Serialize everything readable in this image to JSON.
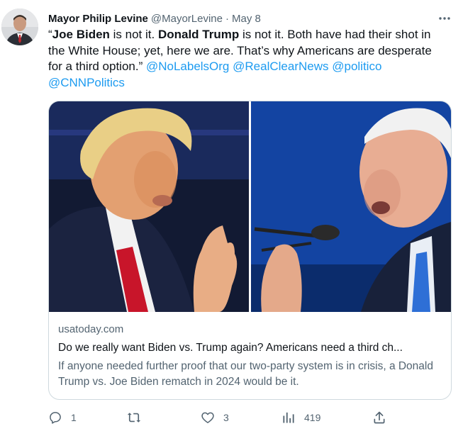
{
  "tweet": {
    "author_name": "Mayor Philip Levine",
    "author_handle": "@MayorLevine",
    "separator": "·",
    "date": "May 8",
    "text": {
      "open_quote": "“",
      "bold_1": "Joe Biden",
      "part_1": " is not it. ",
      "bold_2": "Donald Trump",
      "part_2": " is not it. Both have had their shot in the White House; yet, here we are. That’s why Americans are desperate for a third option.” ",
      "mentions": [
        "@NoLabelsOrg",
        "@RealClearNews",
        "@politico",
        "@CNNPolitics"
      ]
    }
  },
  "card": {
    "domain": "usatoday.com",
    "title": "Do we really want Biden vs. Trump again? Americans need a third ch...",
    "description": "If anyone needed further proof that our two-party system is in crisis, a Donald Trump vs. Joe Biden rematch in 2024 would be it."
  },
  "actions": {
    "reply_count": "1",
    "like_count": "3",
    "view_count": "419"
  },
  "icons": {
    "avatar": "avatar-photo",
    "more": "more-icon",
    "reply": "reply-icon",
    "retweet": "retweet-icon",
    "like": "heart-icon",
    "views": "views-icon",
    "share": "share-icon"
  },
  "colors": {
    "link": "#1d9bf0",
    "secondary": "#536471",
    "border": "#cfd9de",
    "text": "#0f1419"
  }
}
